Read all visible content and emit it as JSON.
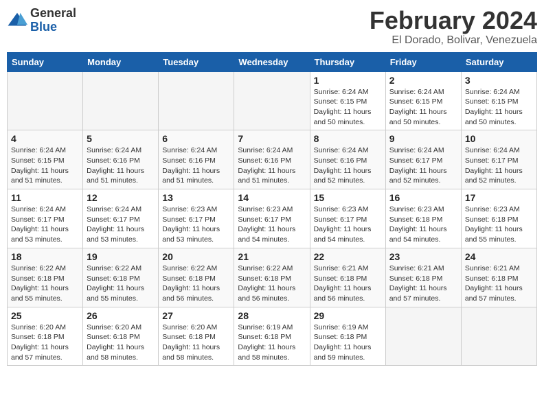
{
  "app": {
    "logo_general": "General",
    "logo_blue": "Blue"
  },
  "title": {
    "month": "February 2024",
    "location": "El Dorado, Bolivar, Venezuela"
  },
  "calendar": {
    "headers": [
      "Sunday",
      "Monday",
      "Tuesday",
      "Wednesday",
      "Thursday",
      "Friday",
      "Saturday"
    ],
    "weeks": [
      [
        {
          "day": "",
          "info": ""
        },
        {
          "day": "",
          "info": ""
        },
        {
          "day": "",
          "info": ""
        },
        {
          "day": "",
          "info": ""
        },
        {
          "day": "1",
          "info": "Sunrise: 6:24 AM\nSunset: 6:15 PM\nDaylight: 11 hours\nand 50 minutes."
        },
        {
          "day": "2",
          "info": "Sunrise: 6:24 AM\nSunset: 6:15 PM\nDaylight: 11 hours\nand 50 minutes."
        },
        {
          "day": "3",
          "info": "Sunrise: 6:24 AM\nSunset: 6:15 PM\nDaylight: 11 hours\nand 50 minutes."
        }
      ],
      [
        {
          "day": "4",
          "info": "Sunrise: 6:24 AM\nSunset: 6:15 PM\nDaylight: 11 hours\nand 51 minutes."
        },
        {
          "day": "5",
          "info": "Sunrise: 6:24 AM\nSunset: 6:16 PM\nDaylight: 11 hours\nand 51 minutes."
        },
        {
          "day": "6",
          "info": "Sunrise: 6:24 AM\nSunset: 6:16 PM\nDaylight: 11 hours\nand 51 minutes."
        },
        {
          "day": "7",
          "info": "Sunrise: 6:24 AM\nSunset: 6:16 PM\nDaylight: 11 hours\nand 51 minutes."
        },
        {
          "day": "8",
          "info": "Sunrise: 6:24 AM\nSunset: 6:16 PM\nDaylight: 11 hours\nand 52 minutes."
        },
        {
          "day": "9",
          "info": "Sunrise: 6:24 AM\nSunset: 6:17 PM\nDaylight: 11 hours\nand 52 minutes."
        },
        {
          "day": "10",
          "info": "Sunrise: 6:24 AM\nSunset: 6:17 PM\nDaylight: 11 hours\nand 52 minutes."
        }
      ],
      [
        {
          "day": "11",
          "info": "Sunrise: 6:24 AM\nSunset: 6:17 PM\nDaylight: 11 hours\nand 53 minutes."
        },
        {
          "day": "12",
          "info": "Sunrise: 6:24 AM\nSunset: 6:17 PM\nDaylight: 11 hours\nand 53 minutes."
        },
        {
          "day": "13",
          "info": "Sunrise: 6:23 AM\nSunset: 6:17 PM\nDaylight: 11 hours\nand 53 minutes."
        },
        {
          "day": "14",
          "info": "Sunrise: 6:23 AM\nSunset: 6:17 PM\nDaylight: 11 hours\nand 54 minutes."
        },
        {
          "day": "15",
          "info": "Sunrise: 6:23 AM\nSunset: 6:17 PM\nDaylight: 11 hours\nand 54 minutes."
        },
        {
          "day": "16",
          "info": "Sunrise: 6:23 AM\nSunset: 6:18 PM\nDaylight: 11 hours\nand 54 minutes."
        },
        {
          "day": "17",
          "info": "Sunrise: 6:23 AM\nSunset: 6:18 PM\nDaylight: 11 hours\nand 55 minutes."
        }
      ],
      [
        {
          "day": "18",
          "info": "Sunrise: 6:22 AM\nSunset: 6:18 PM\nDaylight: 11 hours\nand 55 minutes."
        },
        {
          "day": "19",
          "info": "Sunrise: 6:22 AM\nSunset: 6:18 PM\nDaylight: 11 hours\nand 55 minutes."
        },
        {
          "day": "20",
          "info": "Sunrise: 6:22 AM\nSunset: 6:18 PM\nDaylight: 11 hours\nand 56 minutes."
        },
        {
          "day": "21",
          "info": "Sunrise: 6:22 AM\nSunset: 6:18 PM\nDaylight: 11 hours\nand 56 minutes."
        },
        {
          "day": "22",
          "info": "Sunrise: 6:21 AM\nSunset: 6:18 PM\nDaylight: 11 hours\nand 56 minutes."
        },
        {
          "day": "23",
          "info": "Sunrise: 6:21 AM\nSunset: 6:18 PM\nDaylight: 11 hours\nand 57 minutes."
        },
        {
          "day": "24",
          "info": "Sunrise: 6:21 AM\nSunset: 6:18 PM\nDaylight: 11 hours\nand 57 minutes."
        }
      ],
      [
        {
          "day": "25",
          "info": "Sunrise: 6:20 AM\nSunset: 6:18 PM\nDaylight: 11 hours\nand 57 minutes."
        },
        {
          "day": "26",
          "info": "Sunrise: 6:20 AM\nSunset: 6:18 PM\nDaylight: 11 hours\nand 58 minutes."
        },
        {
          "day": "27",
          "info": "Sunrise: 6:20 AM\nSunset: 6:18 PM\nDaylight: 11 hours\nand 58 minutes."
        },
        {
          "day": "28",
          "info": "Sunrise: 6:19 AM\nSunset: 6:18 PM\nDaylight: 11 hours\nand 58 minutes."
        },
        {
          "day": "29",
          "info": "Sunrise: 6:19 AM\nSunset: 6:18 PM\nDaylight: 11 hours\nand 59 minutes."
        },
        {
          "day": "",
          "info": ""
        },
        {
          "day": "",
          "info": ""
        }
      ]
    ]
  }
}
